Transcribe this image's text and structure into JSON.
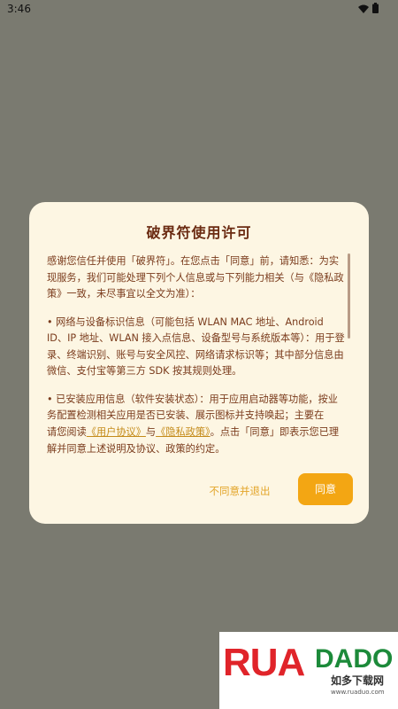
{
  "status_bar": {
    "time": "3:46",
    "wifi_icon": "wifi-icon",
    "battery_icon": "battery-icon"
  },
  "dialog": {
    "title": "破界符使用许可",
    "paragraphs": [
      "感谢您信任并使用「破界符」。在您点击「同意」前，请知悉：为实现服务，我们可能处理下列个人信息或与下列能力相关（与《隐私政策》一致，未尽事宜以全文为准）：",
      "• 网络与设备标识信息（可能包括 WLAN MAC 地址、Android ID、IP 地址、WLAN 接入点信息、设备型号与系统版本等）：用于登录、终端识别、账号与安全风控、网络请求标识等；其中部分信息由微信、支付宝等第三方 SDK 按其规则处理。",
      "• 已安装应用信息（软件安装状态）：用于应用启动器等功能，按业务配置检测相关应用是否已安装、展示图标并支持唤起；主要在"
    ],
    "consent": {
      "prefix": "请您阅读",
      "user_agreement": "《用户协议》",
      "and": "与",
      "privacy_policy": "《隐私政策》",
      "suffix": "。点击「同意」即表示您已理解并同意上述说明及协议、政策的约定。"
    },
    "decline_label": "不同意并退出",
    "agree_label": "同意"
  },
  "watermark": {
    "logo_text_1": "RUA",
    "logo_text_2": "DADO",
    "brand": "如多下载网",
    "url": "www.ruaduo.com"
  },
  "colors": {
    "overlay": "#7a7a70",
    "dialog_bg": "#fdf6e3",
    "accent": "#f3a613",
    "text": "#7a3b1c"
  }
}
